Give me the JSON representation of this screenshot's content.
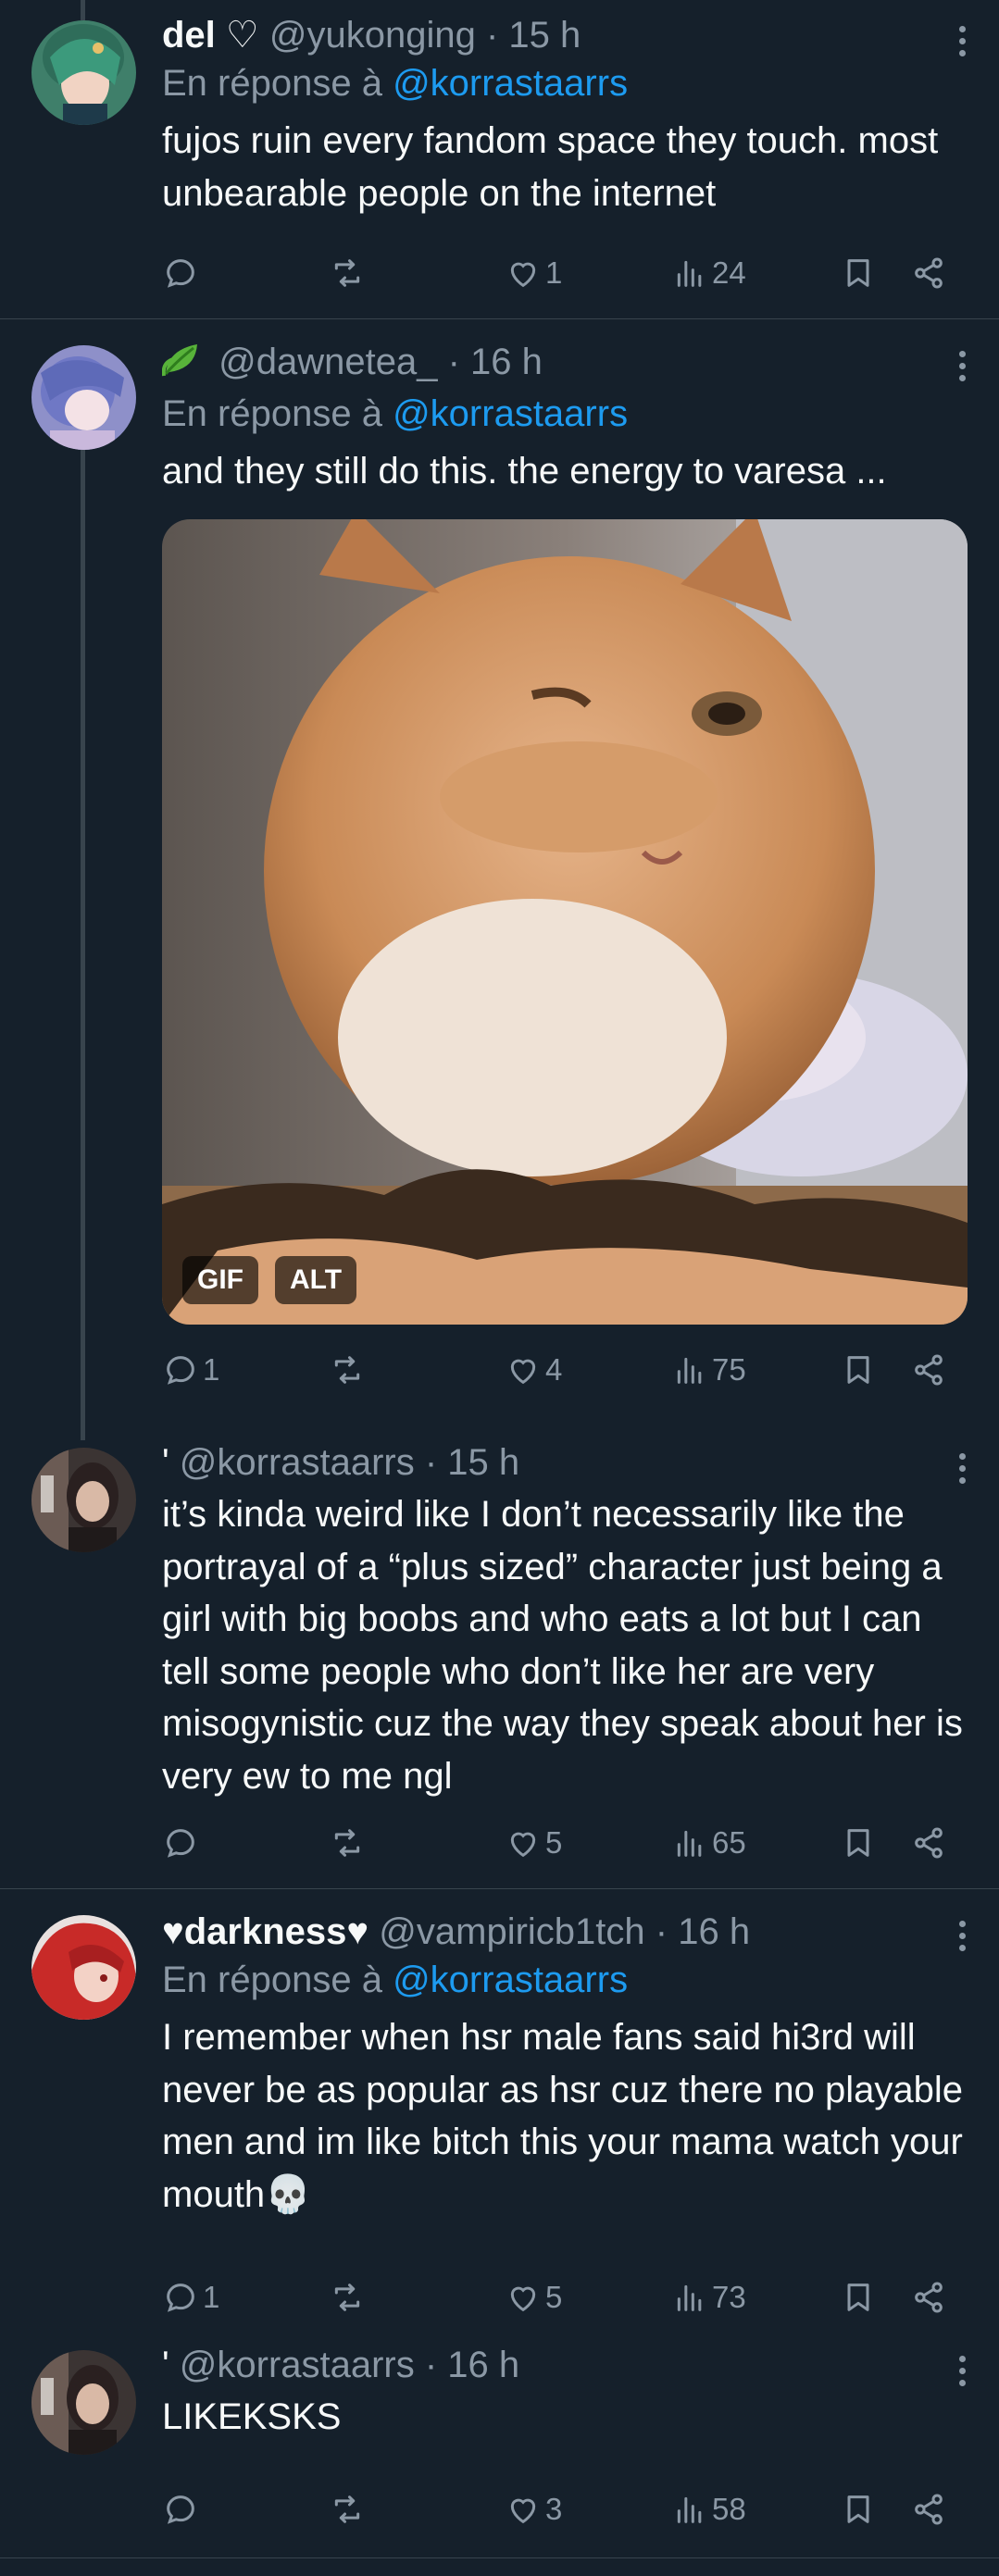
{
  "tweets": [
    {
      "display_name": "del ♡",
      "handle": "@yukonging",
      "time": "· 15 h",
      "reply_prefix": "En réponse à",
      "reply_to": "@korrastaarrs",
      "text": "fujos ruin every fandom space they touch. most unbearable people on the internet",
      "replies": "",
      "reposts": "",
      "likes": "1",
      "views": "24"
    },
    {
      "display_name_icon": "leaf-emoji",
      "handle": "@dawnetea_",
      "time": "· 16 h",
      "reply_prefix": "En réponse à",
      "reply_to": "@korrastaarrs",
      "text": "and they still do this. the energy to varesa ...",
      "media": {
        "badge_gif": "GIF",
        "badge_alt": "ALT"
      },
      "replies": "1",
      "reposts": "",
      "likes": "4",
      "views": "75"
    },
    {
      "handle": "@korrastaarrs",
      "time": "· 15 h",
      "text": "it’s kinda weird like I don’t necessarily like the portrayal of a “plus sized” character just being a girl with big boobs and who eats a lot but I can tell some people who don’t like her are very misogynistic cuz the way they speak about her is very ew to me ngl",
      "replies": "",
      "reposts": "",
      "likes": "5",
      "views": "65"
    },
    {
      "display_name": "♥darkness♥",
      "handle": "@vampiricb1tch",
      "time": "· 16 h",
      "reply_prefix": "En réponse à",
      "reply_to": "@korrastaarrs",
      "text": "I remember when hsr male fans said hi3rd will never be as popular as hsr cuz there no playable men and im like bitch this your mama watch your mouth💀",
      "replies": "1",
      "reposts": "",
      "likes": "5",
      "views": "73"
    },
    {
      "handle": "@korrastaarrs",
      "time": "· 16 h",
      "text": "LIKEKSKS",
      "replies": "",
      "reposts": "",
      "likes": "3",
      "views": "58"
    }
  ],
  "colors": {
    "background": "#15202b",
    "text": "#f7f9f9",
    "secondary": "#8b98a5",
    "link": "#1d9bf0",
    "divider": "#38444d"
  },
  "icons": [
    "reply-icon",
    "repost-icon",
    "like-icon",
    "views-icon",
    "bookmark-icon",
    "share-icon",
    "more-icon"
  ]
}
